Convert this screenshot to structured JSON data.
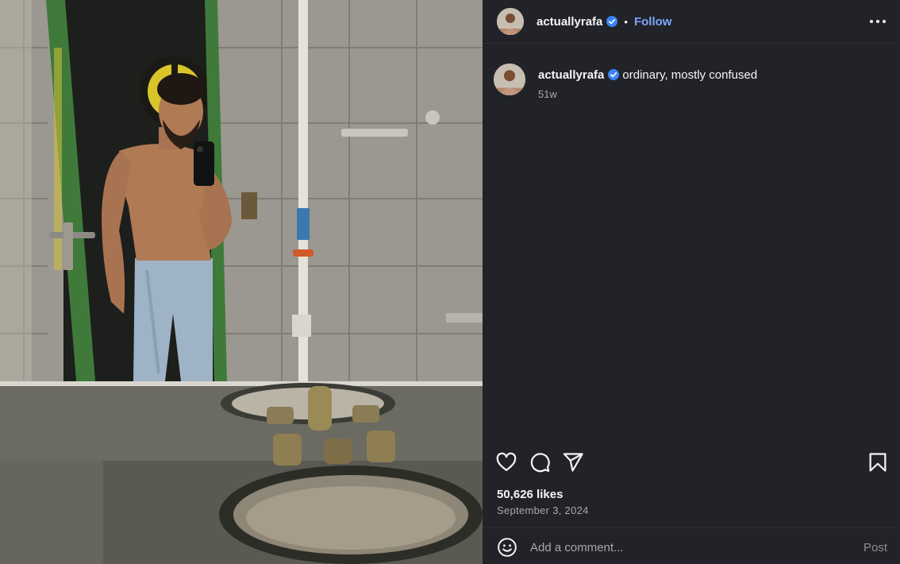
{
  "post": {
    "username": "actuallyrafa",
    "verified": true,
    "follow_label": "Follow",
    "separator": "•",
    "caption": "ordinary, mostly confused",
    "age": "51w",
    "likes": "50,626 likes",
    "date": "September 3, 2024"
  },
  "comment": {
    "placeholder": "Add a comment...",
    "post_label": "Post"
  },
  "icons": {
    "verified": "verified-badge-icon",
    "more": "more-options-icon",
    "like": "heart-icon",
    "comment": "comment-bubble-icon",
    "share": "paper-plane-icon",
    "save": "bookmark-icon",
    "emoji": "emoji-smiley-icon"
  },
  "colors": {
    "panel_bg": "#212328",
    "follow": "#7ea4ff",
    "verified": "#3b82f6",
    "muted": "#a8a8a8"
  }
}
